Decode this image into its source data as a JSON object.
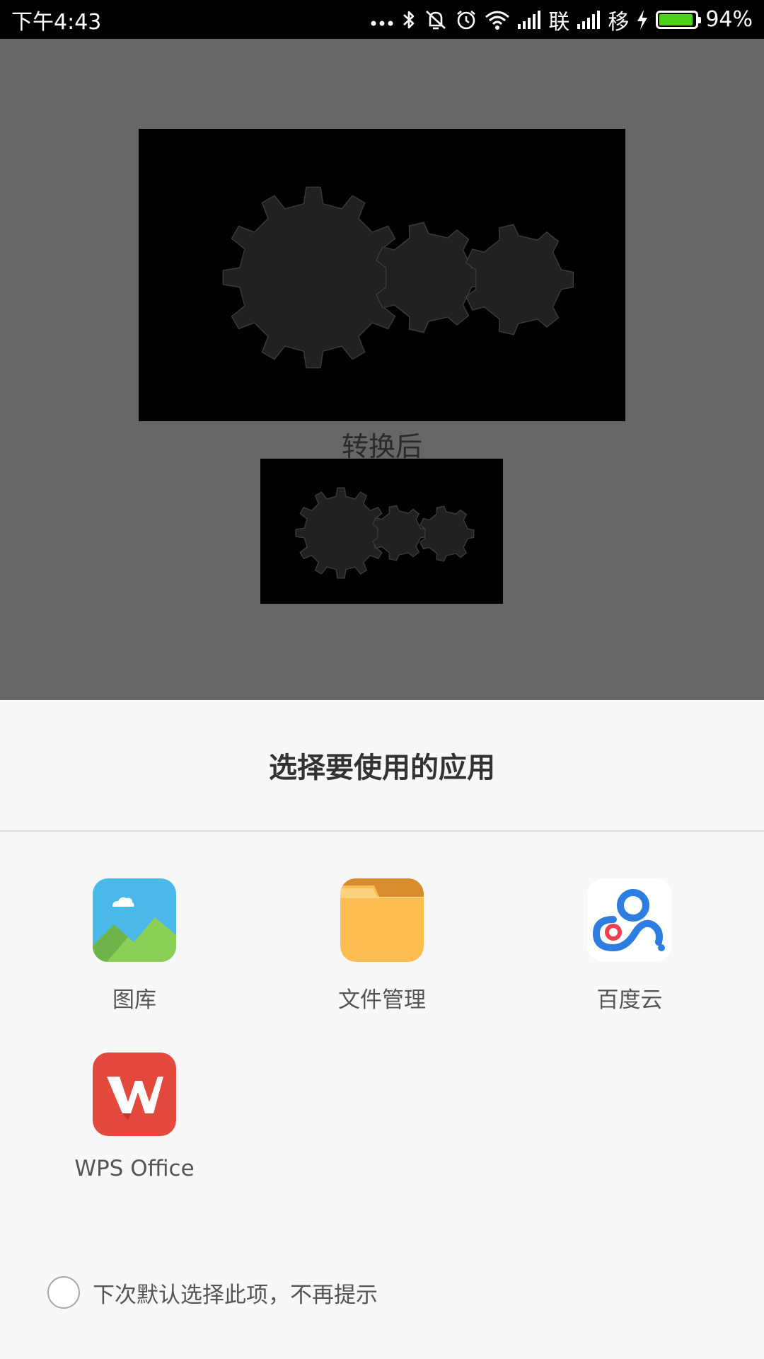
{
  "status_bar": {
    "time": "下午4:43",
    "carrier1": "联",
    "carrier2": "移",
    "battery_percent": "94%",
    "battery_level": 0.94,
    "icons": [
      "more-dots-icon",
      "bluetooth-icon",
      "vibrate-mute-icon",
      "alarm-icon",
      "wifi-icon",
      "signal-icon",
      "charging-icon",
      "battery-icon"
    ]
  },
  "background": {
    "caption": "转换后"
  },
  "chooser": {
    "title": "选择要使用的应用",
    "apps": [
      {
        "label": "图库",
        "icon": "gallery-icon"
      },
      {
        "label": "文件管理",
        "icon": "file-manager-icon"
      },
      {
        "label": "百度云",
        "icon": "baidu-cloud-icon"
      },
      {
        "label": "WPS Office",
        "icon": "wps-office-icon"
      }
    ],
    "remember_label": "下次默认选择此项，不再提示"
  },
  "colors": {
    "gallery_sky": "#4ab9ea",
    "gallery_hill": "#8ccf57",
    "folder": "#fbbd4f",
    "folder_tab": "#d88e2f",
    "baidu_blue": "#2e7de1",
    "baidu_red": "#e8434f",
    "wps_red": "#e4493d"
  }
}
